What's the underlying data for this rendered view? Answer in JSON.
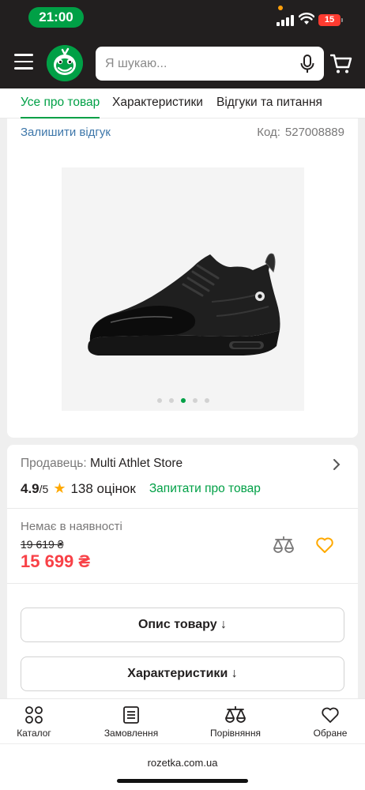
{
  "status_bar": {
    "time": "21:00",
    "battery": "15"
  },
  "header": {
    "search_placeholder": "Я шукаю..."
  },
  "tabs": [
    {
      "label": "Усе про товар",
      "active": true
    },
    {
      "label": "Характеристики",
      "active": false
    },
    {
      "label": "Відгуки та питання",
      "active": false
    }
  ],
  "product": {
    "leave_review": "Залишити відгук",
    "code_label": "Код:",
    "code_value": "527008889",
    "gallery_total": 5,
    "gallery_current": 3
  },
  "seller": {
    "label": "Продавець:",
    "name": "Multi Athlet Store"
  },
  "rating": {
    "score": "4.9",
    "out_of": "/5",
    "count": "138 оцінок",
    "ask_question": "Запитати про товар"
  },
  "price": {
    "availability": "Немає в наявності",
    "old_price": "19 619 ₴",
    "current_price": "15 699 ₴"
  },
  "buttons": {
    "description": "Опис товару ↓",
    "characteristics": "Характеристики ↓"
  },
  "bottom_nav": [
    {
      "label": "Каталог",
      "icon": "catalog-icon"
    },
    {
      "label": "Замовлення",
      "icon": "orders-icon"
    },
    {
      "label": "Порівняння",
      "icon": "compare-icon"
    },
    {
      "label": "Обране",
      "icon": "heart-icon"
    }
  ],
  "browser": {
    "url": "rozetka.com.ua"
  },
  "colors": {
    "brand_green": "#00a046",
    "header_dark": "#221f1f",
    "price_red": "#f84147",
    "link_blue": "#3e77aa",
    "star_orange": "#ffa900"
  }
}
